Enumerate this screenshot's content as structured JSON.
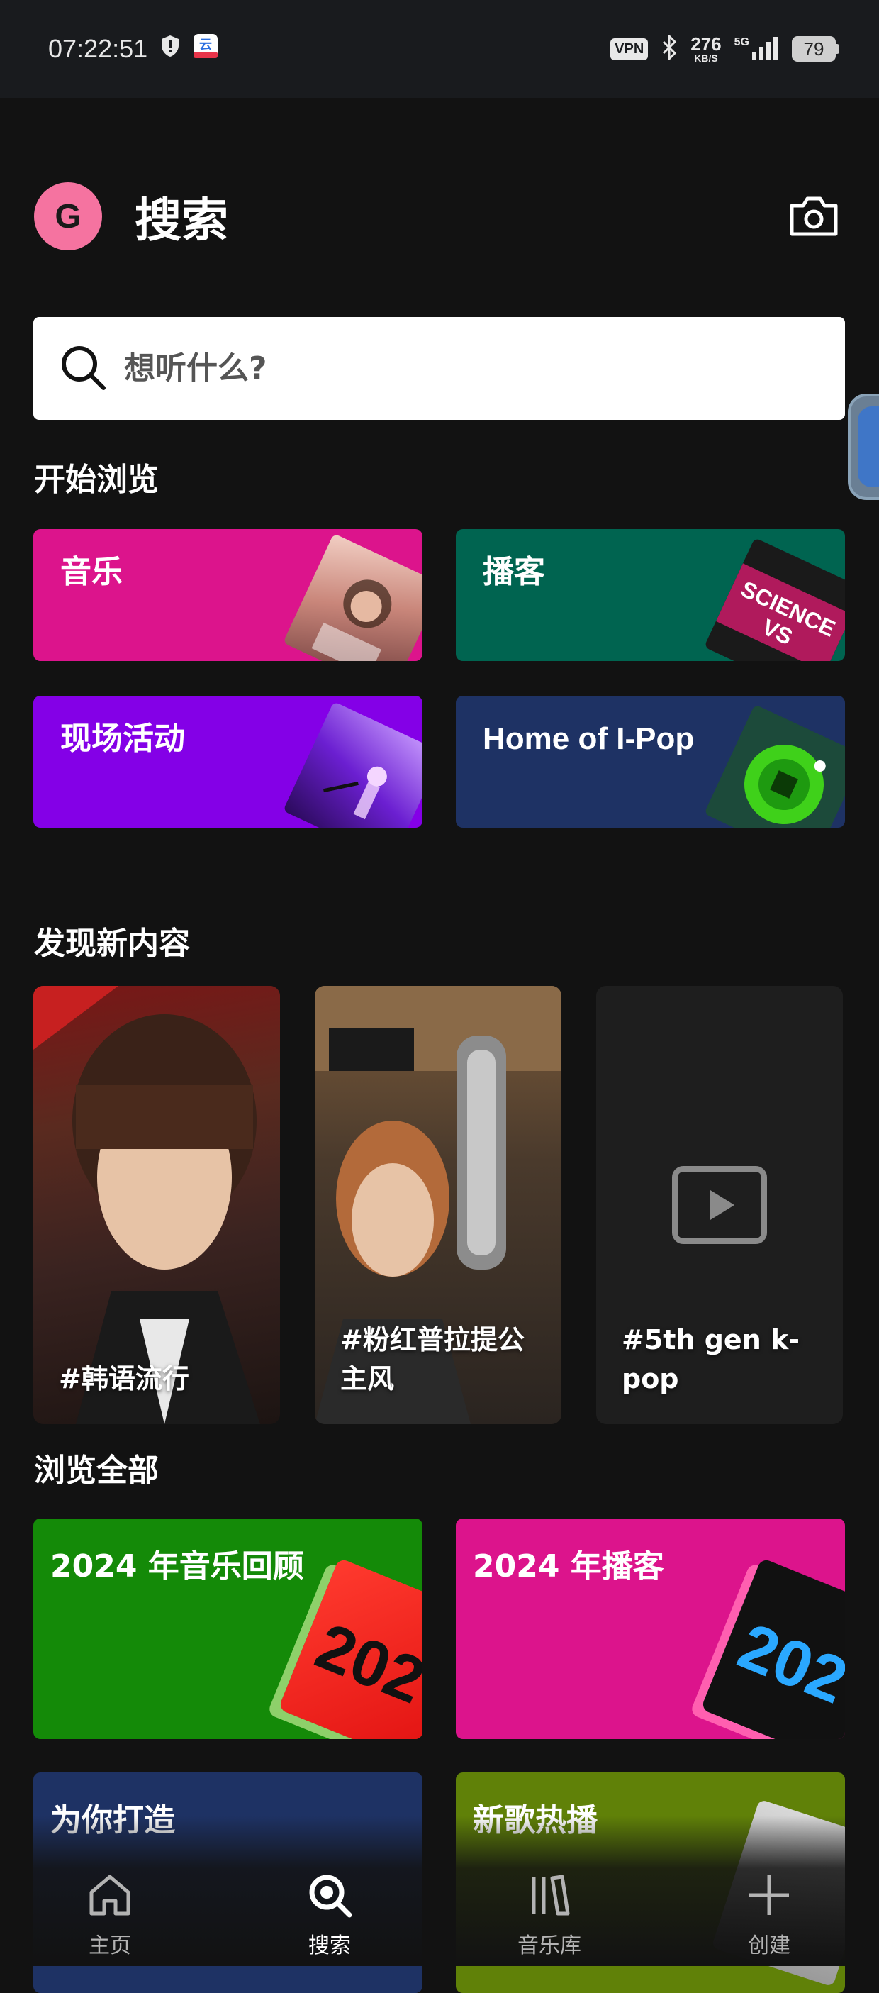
{
  "status_bar": {
    "time": "07:22:51",
    "vpn": "VPN",
    "net_speed": "276",
    "net_unit": "KB/S",
    "network": "5G",
    "battery": "79"
  },
  "header": {
    "avatar_letter": "G",
    "title": "搜索"
  },
  "search": {
    "placeholder": "想听什么?"
  },
  "start_browsing": {
    "title": "开始浏览",
    "tiles": [
      {
        "label": "音乐",
        "color": "#dc148c"
      },
      {
        "label": "播客",
        "color": "#006450"
      },
      {
        "label": "现场活动",
        "color": "#8400e7"
      },
      {
        "label": "Home of I-Pop",
        "color": "#1e3264"
      }
    ]
  },
  "discover": {
    "title": "发现新内容",
    "items": [
      {
        "tag": "#韩语流行"
      },
      {
        "tag": "#粉红普拉提公主风"
      },
      {
        "tag": "#5th gen k-pop"
      }
    ]
  },
  "browse_all": {
    "title": "浏览全部",
    "tiles": [
      {
        "label": "2024 年音乐回顾",
        "art_text": "202",
        "color": "#148a08"
      },
      {
        "label": "2024 年播客",
        "art_text": "202",
        "color": "#dc148c"
      },
      {
        "label": "为你打造",
        "color": "#1e3264"
      },
      {
        "label": "新歌热播",
        "color": "#608108"
      }
    ]
  },
  "bottom_nav": {
    "items": [
      {
        "label": "主页",
        "icon": "home-icon"
      },
      {
        "label": "搜索",
        "icon": "search-icon",
        "active": true
      },
      {
        "label": "音乐库",
        "icon": "library-icon"
      },
      {
        "label": "创建",
        "icon": "plus-icon"
      }
    ]
  }
}
